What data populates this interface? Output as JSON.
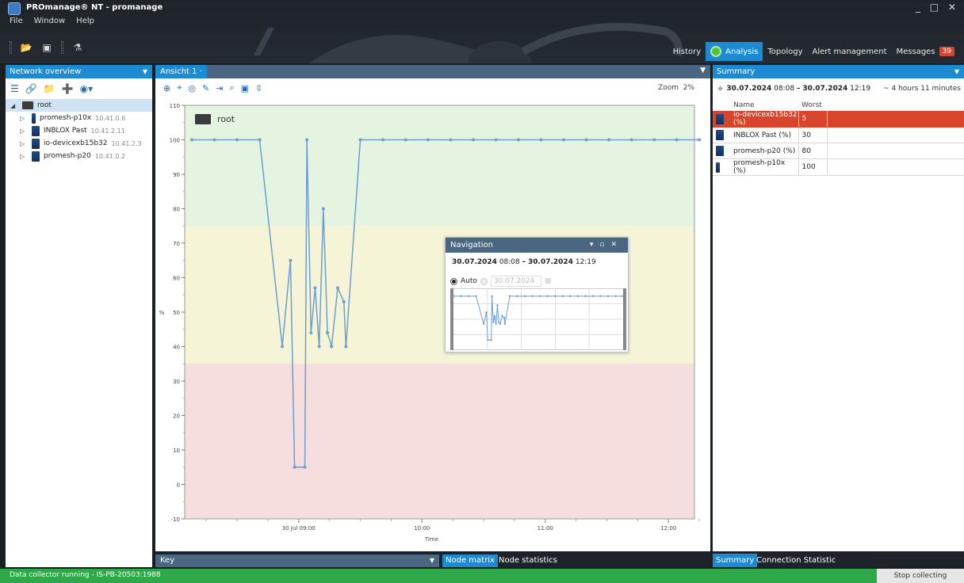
{
  "app": {
    "title": "PROmanage® NT - promanage",
    "window_controls": "_ □ ✕",
    "menu": [
      "File",
      "Window",
      "Help"
    ]
  },
  "nav_tabs": [
    {
      "label": "History",
      "active": false
    },
    {
      "label": "Analysis",
      "active": true
    },
    {
      "label": "Topology",
      "active": false
    },
    {
      "label": "Alert management",
      "active": false
    },
    {
      "label": "Messages",
      "active": false,
      "badge": "39"
    }
  ],
  "left_panel": {
    "title": "Network overview",
    "tree": {
      "root": "root",
      "children": [
        {
          "name": "promesh-p10x",
          "ip": "10.41.0.6",
          "icon": "switch-thin-icon"
        },
        {
          "name": "INBLOX Past",
          "ip": "10.41.2.11",
          "icon": "inblox-icon"
        },
        {
          "name": "io-devicexb15b32",
          "ip": "10.41.2.3",
          "icon": "io-device-icon"
        },
        {
          "name": "promesh-p20",
          "ip": "10.41.0.2",
          "icon": "switch-icon"
        }
      ]
    }
  },
  "center_panel": {
    "tab": "Ansicht 1",
    "zoom_label": "Zoom",
    "zoom_value": "2%",
    "chart_title": "root",
    "key_label": "Key",
    "bottom_tabs": [
      "Node matrix",
      "Node statistics"
    ]
  },
  "chart_data": {
    "type": "line",
    "xlabel": "Time",
    "ylabel": "%",
    "ylim": [
      -10,
      110
    ],
    "yticks": [
      110,
      100,
      90,
      80,
      70,
      60,
      50,
      40,
      30,
      20,
      10,
      0,
      -10
    ],
    "xticks": [
      "30 Jul 09:00",
      "10:00",
      "11:00",
      "12:00"
    ],
    "x_start": "08:08",
    "x_end": "12:19",
    "bands": [
      {
        "from": 75,
        "to": 110,
        "color": "#e4f4e0"
      },
      {
        "from": 35,
        "to": 75,
        "color": "#f6f4d6"
      },
      {
        "from": -10,
        "to": 35,
        "color": "#f6dede"
      }
    ],
    "series": [
      {
        "color": "#6b9fd4",
        "x_minutes": [
          0,
          11,
          22,
          33,
          44,
          48,
          50,
          55,
          56,
          58,
          60,
          62,
          64,
          66,
          68,
          71,
          74,
          75,
          82,
          93,
          104,
          115,
          126,
          137,
          148,
          159,
          170,
          181,
          192,
          203,
          214,
          225,
          236,
          247
        ],
        "y": [
          100,
          100,
          100,
          100,
          40,
          65,
          5,
          5,
          100,
          44,
          57,
          40,
          80,
          44,
          40,
          57,
          53,
          40,
          100,
          100,
          100,
          100,
          100,
          100,
          100,
          100,
          100,
          100,
          100,
          100,
          100,
          100,
          100,
          100
        ]
      }
    ]
  },
  "navigation": {
    "title": "Navigation",
    "range_start_date": "30.07.2024",
    "range_start_time": "08:08",
    "range_sep": "–",
    "range_end_date": "30.07.2024",
    "range_end_time": "12:19",
    "auto_label": "Auto",
    "date_field": "30.07.2024"
  },
  "right_panel": {
    "title": "Summary",
    "range_start_date": "30.07.2024",
    "range_start_time": "08:08",
    "range_sep": "–",
    "range_end_date": "30.07.2024",
    "range_end_time": "12:19",
    "duration": "~ 4 hours 11 minutes",
    "columns": [
      "Name",
      "Worst"
    ],
    "rows": [
      {
        "name": "io-devicexb15b32 (%)",
        "worst": "5",
        "selected": true
      },
      {
        "name": "INBLOX Past (%)",
        "worst": "30",
        "selected": false
      },
      {
        "name": "promesh-p20 (%)",
        "worst": "80",
        "selected": false
      },
      {
        "name": "promesh-p10x (%)",
        "worst": "100",
        "selected": false
      }
    ],
    "bottom_tabs": [
      "Summary",
      "Connection Statistic"
    ]
  },
  "status": {
    "text": "Data collector running - IS-PB-20503:1988",
    "stop_button": "Stop collecting"
  },
  "colors": {
    "accent": "#1c8bd1",
    "alert": "#d9452c",
    "status_green": "#2fa84a",
    "header_dark": "#1e2329"
  }
}
